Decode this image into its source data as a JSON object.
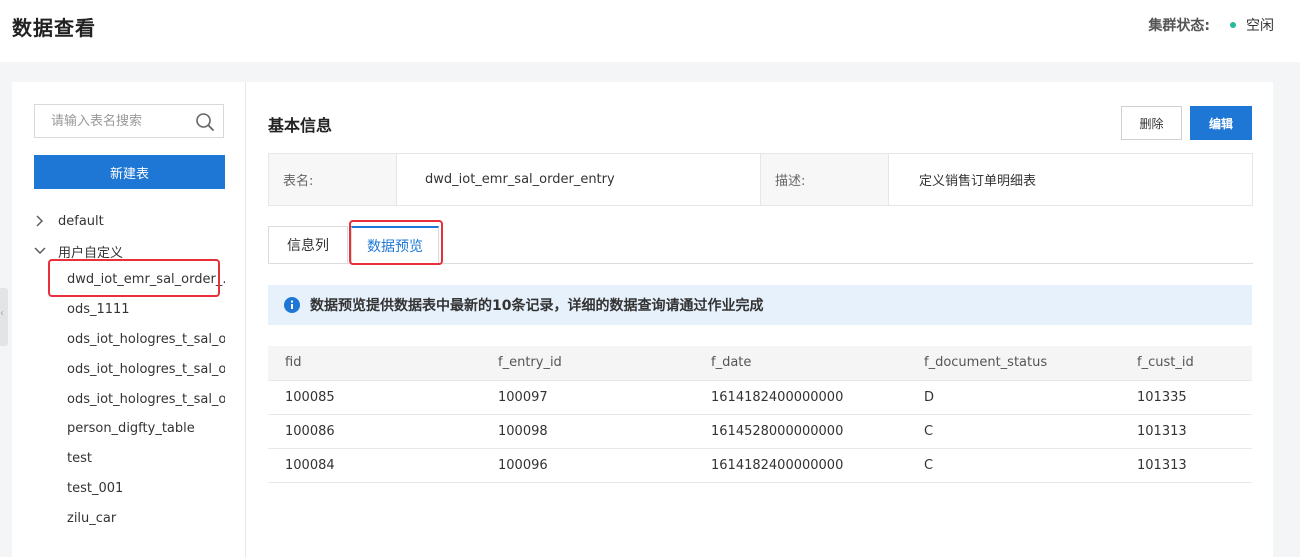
{
  "header": {
    "title": "数据查看",
    "cluster_label": "集群状态:",
    "cluster_value": "空闲",
    "cluster_status_color": "#27b99a"
  },
  "sidebar": {
    "search_placeholder": "请输入表名搜索",
    "new_table_label": "新建表",
    "groups": [
      {
        "label": "default",
        "expanded": false
      },
      {
        "label": "用户自定义",
        "expanded": true
      }
    ],
    "tables": [
      "dwd_iot_emr_sal_order_...",
      "ods_1111",
      "ods_iot_hologres_t_sal_o...",
      "ods_iot_hologres_t_sal_o...",
      "ods_iot_hologres_t_sal_o...",
      "person_digfty_table",
      "test",
      "test_001",
      "zilu_car"
    ]
  },
  "main": {
    "section_title": "基本信息",
    "delete_label": "删除",
    "edit_label": "编辑",
    "info": {
      "name_key": "表名:",
      "name_value": "dwd_iot_emr_sal_order_entry",
      "desc_key": "描述:",
      "desc_value": "定义销售订单明细表"
    },
    "tabs": [
      {
        "label": "信息列",
        "active": false
      },
      {
        "label": "数据预览",
        "active": true
      }
    ],
    "notice": "数据预览提供数据表中最新的10条记录，详细的数据查询请通过作业完成",
    "table": {
      "columns": [
        "fid",
        "f_entry_id",
        "f_date",
        "f_document_status",
        "f_cust_id"
      ],
      "rows": [
        [
          "100085",
          "100097",
          "1614182400000000",
          "D",
          "101335"
        ],
        [
          "100086",
          "100098",
          "1614528000000000",
          "C",
          "101313"
        ],
        [
          "100084",
          "100096",
          "1614182400000000",
          "C",
          "101313"
        ]
      ]
    }
  },
  "colors": {
    "primary": "#1e77d4",
    "highlight": "#e8303b"
  }
}
